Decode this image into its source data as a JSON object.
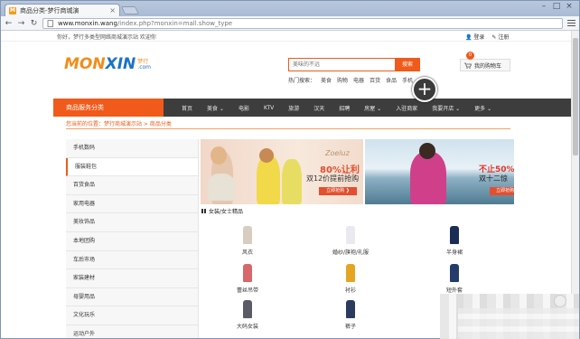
{
  "browser": {
    "tab_title": "商品分类-梦行商城演",
    "favicon": "M",
    "url_host": "www.monxin.wang",
    "url_path": "/index.php?monxin=mall.show_type"
  },
  "site": {
    "welcome": "你好，梦行多类型网络商城演示站 欢迎你",
    "login": "登录",
    "register": "注册",
    "logo_main_a": "MON",
    "logo_main_b": "XIN",
    "logo_sub_top": "梦行",
    "logo_sub_bottom": ".com",
    "search_placeholder": "美味的不远",
    "search_button": "搜索",
    "hot_label": "热门搜索：",
    "hot_words": [
      "美食",
      "购物",
      "电器",
      "百货",
      "食品",
      "手机",
      "建材"
    ],
    "cart_label": "我的购物车",
    "cart_count": "0"
  },
  "nav": {
    "category_title": "商品服务分类",
    "items": [
      "首页",
      "美食 ⌄",
      "电影",
      "KTV",
      "旅游",
      "汉天",
      "招聘",
      "房屋 ⌄",
      "入驻商家",
      "我要开店 ⌄",
      "更多 ⌄"
    ]
  },
  "breadcrumb": "您当前的位置：梦行商城演示站 > 商品分类",
  "sidebar": {
    "items": [
      "手机数码",
      "服装鞋包",
      "百货食品",
      "家用电器",
      "美妆饰品",
      "本地团购",
      "车后市场",
      "家装建材",
      "母婴用品",
      "文化玩乐",
      "运动户外"
    ],
    "active_index": 1
  },
  "banner1": {
    "brand": "Zoeluz",
    "headline": "80%让利",
    "subline": "双12价提前抢购",
    "button": "立即抢购 ❯"
  },
  "banner2": {
    "headline": "不止50%",
    "subline": "双十二惊",
    "button": "立即抢购 ❯"
  },
  "section": {
    "title": "女装/女士精品",
    "products": [
      {
        "name": "风衣",
        "color": "#d8cdbf"
      },
      {
        "name": "婚纱/旗袍/礼服",
        "color": "#e9e9ef"
      },
      {
        "name": "半身裙",
        "color": "#1b2c55"
      },
      {
        "name": "蕾丝吊带",
        "color": "#d7676b"
      },
      {
        "name": "衬衫",
        "color": "#e4a622"
      },
      {
        "name": "短外套",
        "color": "#253c6a"
      },
      {
        "name": "大码女装",
        "color": "#5b5b65"
      },
      {
        "name": "裤子",
        "color": "#2a3b5e"
      }
    ]
  },
  "colors": {
    "accent": "#f05a1a",
    "nav_bg": "#3d3d3d",
    "logo_orange": "#f28c1b",
    "logo_blue": "#1b73c7"
  }
}
